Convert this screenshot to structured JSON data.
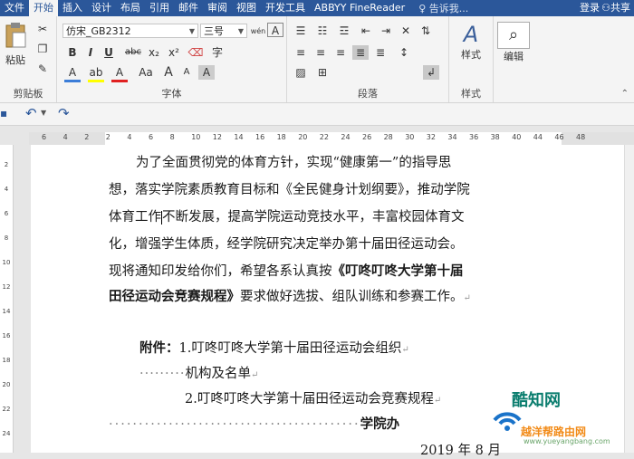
{
  "tabs": {
    "file": "文件",
    "home": "开始",
    "insert": "插入",
    "design": "设计",
    "layout": "布局",
    "references": "引用",
    "mailings": "邮件",
    "review": "审阅",
    "view": "视图",
    "developer": "开发工具",
    "abbyy": "ABBYY FineReader",
    "tell_me": "告诉我...",
    "login": "登录",
    "share": "共享"
  },
  "ribbon": {
    "clipboard": {
      "paste": "粘贴",
      "label": "剪贴板"
    },
    "font": {
      "family": "仿宋_GB2312",
      "size": "三号",
      "wen": "wén",
      "label": "字体",
      "bold": "B",
      "italic": "I",
      "underline": "U",
      "strike": "abc",
      "sub": "x₂",
      "sup": "x²",
      "color_a": "A",
      "case": "Aa",
      "grow": "A",
      "shrink": "A",
      "enclose": "字",
      "highlight": "ab",
      "charshade": "A",
      "border": "A"
    },
    "paragraph": {
      "label": "段落"
    },
    "styles": {
      "button": "样式",
      "label": "样式"
    },
    "editing": {
      "button": "编辑"
    }
  },
  "ruler": {
    "numbers": [
      "6",
      "4",
      "2",
      "2",
      "4",
      "6",
      "8",
      "10",
      "12",
      "14",
      "16",
      "18",
      "20",
      "22",
      "24",
      "26",
      "28",
      "30",
      "32",
      "34",
      "36",
      "38",
      "40",
      "44",
      "46",
      "48"
    ]
  },
  "vruler": {
    "numbers": [
      "2",
      "4",
      "6",
      "8",
      "10",
      "12",
      "14",
      "16",
      "18",
      "20",
      "22",
      "24"
    ]
  },
  "document": {
    "l1": "为了全面贯彻党的体育方针，实现“健康第一”的指导思",
    "l2": "想，落实学院素质教育目标和《全民健身计划纲要》，推动学院",
    "l3a": "体育工作",
    "l3b": "不断发展，提高学院运动竞技水平，丰富校园体育文",
    "l4": "化，增强学生体质，经学院研究决定举办第十届田径运动会。",
    "l5a": "现将通知印发给你们，希望各系认真按",
    "l5b": "《叮咚叮咚大学第十届",
    "l6a": "田径运动会竞赛规程》",
    "l6b": "要求做好选拔、组队训练和参赛工作。",
    "att_label": "附件：",
    "att1": "1.叮咚叮咚大学第十届田径运动会组织",
    "att1b": "机构及名单",
    "att2": "2.叮咚叮咚大学第十届田径运动会竞赛规程",
    "sign": "学院办",
    "date": "2019 年 8 月",
    "para_mark": "↵",
    "dots": "·········"
  },
  "watermark": {
    "brand": "酷知网",
    "site": "越洋帮路由网",
    "url": "www.yueyangbang.com"
  }
}
